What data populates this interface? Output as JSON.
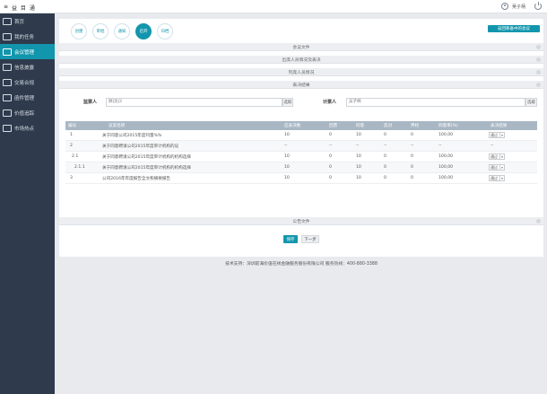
{
  "app": {
    "title": "益 目 通",
    "user_name": "吴子柄"
  },
  "sidebar": {
    "items": [
      {
        "label": "首页"
      },
      {
        "label": "我的任务"
      },
      {
        "label": "会议管理"
      },
      {
        "label": "信息披露"
      },
      {
        "label": "交易合规"
      },
      {
        "label": "函件管理"
      },
      {
        "label": "价值追踪"
      },
      {
        "label": "市场热点"
      }
    ]
  },
  "tabs": [
    {
      "label": "创建"
    },
    {
      "label": "审批"
    },
    {
      "label": "通知"
    },
    {
      "label": "召开"
    },
    {
      "label": "归档"
    }
  ],
  "back_button": "返回筹备中的会议",
  "sections": {
    "meeting_docs": "会议文件",
    "attendees": "出席人员情况及表决",
    "observers": "列席人员情况",
    "vote_results": "表决结果",
    "announcement": "公告文件"
  },
  "form": {
    "supervisor_label": "监票人",
    "supervisor_value": "顾|沈|3",
    "supervisor_btn": "选取",
    "counter_label": "计票人",
    "counter_value": "吴子柄",
    "counter_btn": "选取"
  },
  "table": {
    "headers": [
      "编号",
      "议案名称",
      "应表决数",
      "回票",
      "同意",
      "反对",
      "弃权",
      "同意率(%)",
      "表决结果"
    ],
    "rows": [
      {
        "no": "1",
        "name": "关于同意公司2015年度刊量%%",
        "due": "10",
        "returned": "0",
        "agree": "10",
        "oppose": "0",
        "abstain": "0",
        "rate": "100,00",
        "result": "通过"
      },
      {
        "no": "2",
        "name": "关于同意聘请公司2015年度审计机构的议",
        "due": "--",
        "returned": "--",
        "agree": "--",
        "oppose": "--",
        "abstain": "--",
        "rate": "--",
        "result": "--"
      },
      {
        "no": "2.1",
        "name": "关于同意聘请公司2015年度审计机构的机构选择",
        "due": "10",
        "returned": "0",
        "agree": "10",
        "oppose": "0",
        "abstain": "0",
        "rate": "100,00",
        "result": "通过"
      },
      {
        "no": "2.1.1",
        "name": "关于同意聘请公司2015年度审计机构的机构选择",
        "due": "10",
        "returned": "0",
        "agree": "10",
        "oppose": "0",
        "abstain": "0",
        "rate": "100,00",
        "result": "通过"
      },
      {
        "no": "3",
        "name": "公司2016年年度报告全文和摘要报告",
        "due": "10",
        "returned": "0",
        "agree": "10",
        "oppose": "0",
        "abstain": "0",
        "rate": "100,00",
        "result": "通过"
      }
    ],
    "dropdown_arrow": "▾"
  },
  "buttons": {
    "save": "保存",
    "next": "下一步"
  },
  "footer": "技术支持：深圳前海价值在线金融服务股份有限公司  服务热线：400-880-3388",
  "icons": {
    "logo": "≡",
    "colors": {
      "accent": "#1296ad",
      "sidebar": "#2f3b4c",
      "header_row": "#a9b7c4"
    }
  }
}
